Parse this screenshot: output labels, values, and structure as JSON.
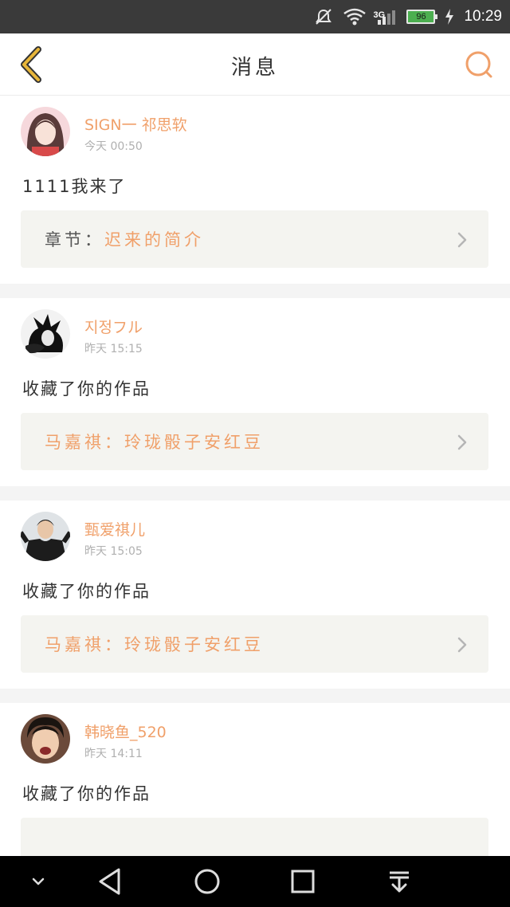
{
  "status_bar": {
    "network": "3G",
    "battery": "96",
    "time": "10:29"
  },
  "header": {
    "title": "消息"
  },
  "messages": [
    {
      "username": "SIGN一 祁思软",
      "time": "今天 00:50",
      "content": "1111我来了",
      "ref_prefix": "章节：",
      "ref_title": "迟来的简介"
    },
    {
      "username": "지정フル",
      "time": "昨天 15:15",
      "content": "收藏了你的作品",
      "ref_prefix": "马嘉祺：",
      "ref_title": "玲珑骰子安红豆"
    },
    {
      "username": "甄爱祺儿",
      "time": "昨天 15:05",
      "content": "收藏了你的作品",
      "ref_prefix": "马嘉祺：",
      "ref_title": "玲珑骰子安红豆"
    },
    {
      "username": "韩晓鱼_520",
      "time": "昨天 14:11",
      "content": "收藏了你的作品"
    }
  ],
  "colors": {
    "accent": "#f0a06a",
    "back_arrow": "#e8a92a",
    "ref_background": "#f4f4f0"
  }
}
